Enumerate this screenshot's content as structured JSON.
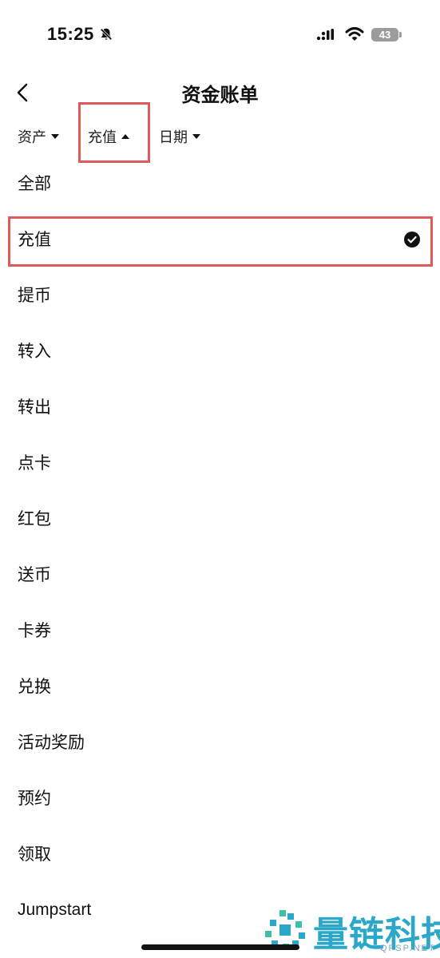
{
  "status_bar": {
    "time": "15:25",
    "battery": "43",
    "icons": [
      "bell-off-icon",
      "signal-icon",
      "wifi-icon",
      "battery-icon"
    ]
  },
  "header": {
    "title": "资金账单",
    "back_icon": "chevron-left-icon"
  },
  "filters": [
    {
      "label": "资产",
      "state": "collapsed"
    },
    {
      "label": "充值",
      "state": "expanded"
    },
    {
      "label": "日期",
      "state": "collapsed"
    }
  ],
  "options": [
    {
      "label": "全部",
      "selected": false
    },
    {
      "label": "充值",
      "selected": true
    },
    {
      "label": "提币",
      "selected": false
    },
    {
      "label": "转入",
      "selected": false
    },
    {
      "label": "转出",
      "selected": false
    },
    {
      "label": "点卡",
      "selected": false
    },
    {
      "label": "红包",
      "selected": false
    },
    {
      "label": "送币",
      "selected": false
    },
    {
      "label": "卡券",
      "selected": false
    },
    {
      "label": "兑换",
      "selected": false
    },
    {
      "label": "活动奖励",
      "selected": false
    },
    {
      "label": "预约",
      "selected": false
    },
    {
      "label": "领取",
      "selected": false
    },
    {
      "label": "Jumpstart",
      "selected": false
    }
  ],
  "colors": {
    "annotation_red": "#e05a5a",
    "text": "#111111",
    "watermark": "#2aa7c9"
  },
  "watermark": {
    "text": "量链科技",
    "sub": "QFSP.NET"
  }
}
